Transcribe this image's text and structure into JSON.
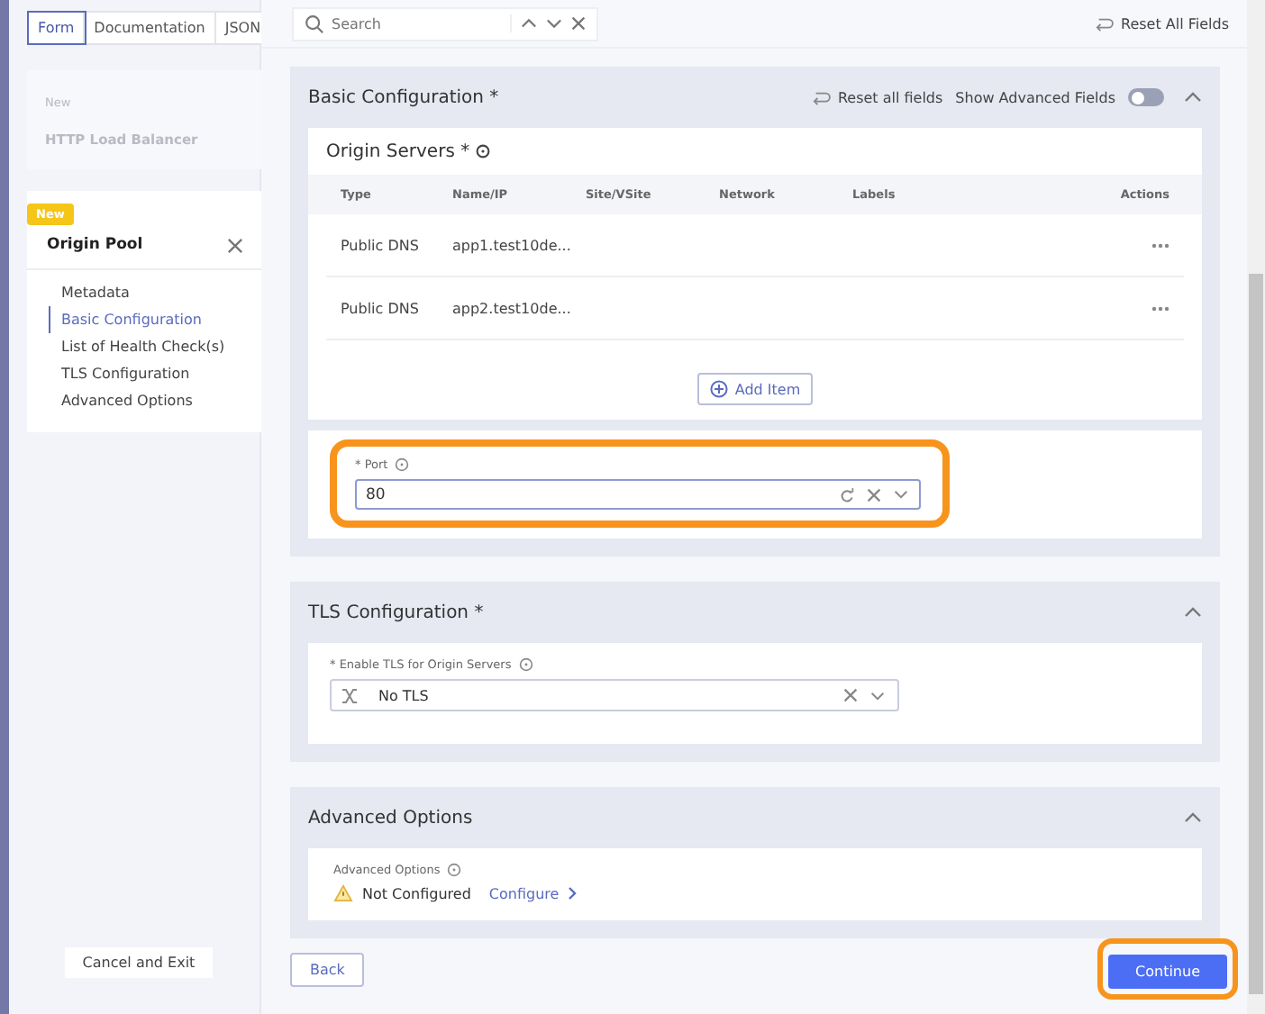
{
  "view_tabs": [
    {
      "label": "Form",
      "selected": true
    },
    {
      "label": "Documentation",
      "selected": false
    },
    {
      "label": "JSON",
      "selected": false
    }
  ],
  "search": {
    "placeholder": "Search"
  },
  "reset_all_fields": "Reset All Fields",
  "sidebar": {
    "parent": {
      "badge": "New",
      "title": "HTTP Load Balancer"
    },
    "current": {
      "badge": "New",
      "title": "Origin Pool",
      "items": [
        {
          "label": "Metadata",
          "selected": false
        },
        {
          "label": "Basic Configuration",
          "selected": true
        },
        {
          "label": "List of Health Check(s)",
          "selected": false
        },
        {
          "label": "TLS Configuration",
          "selected": false
        },
        {
          "label": "Advanced Options",
          "selected": false
        }
      ]
    },
    "cancel_button": "Cancel and Exit"
  },
  "basic_configuration": {
    "title": "Basic Configuration *",
    "reset_link": "Reset all fields",
    "advanced_toggle": {
      "label": "Show Advanced Fields",
      "on": false
    },
    "origin_servers": {
      "title": "Origin Servers *",
      "columns": [
        "Type",
        "Name/IP",
        "Site/VSite",
        "Network",
        "Labels",
        "Actions"
      ],
      "rows": [
        {
          "type": "Public DNS",
          "name": "app1.test10de..."
        },
        {
          "type": "Public DNS",
          "name": "app2.test10de..."
        }
      ],
      "add_button": "Add Item"
    },
    "port": {
      "label": "* Port",
      "value": "80",
      "highlighted": true
    }
  },
  "tls_configuration": {
    "title": "TLS Configuration *",
    "field": {
      "label": "* Enable TLS for Origin Servers",
      "value": "No TLS"
    }
  },
  "advanced_options": {
    "title": "Advanced Options",
    "field_label": "Advanced Options",
    "status": "Not Configured",
    "configure_link": "Configure"
  },
  "back_button": "Back",
  "continue_button": {
    "label": "Continue",
    "highlighted": true
  }
}
